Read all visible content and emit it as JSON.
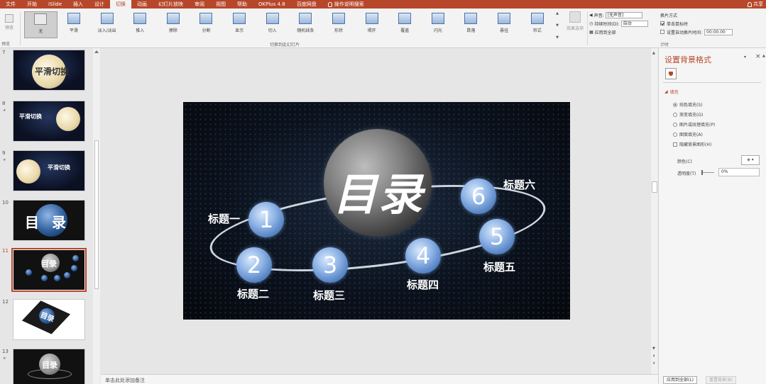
{
  "tabs": [
    "文件",
    "开始",
    "iSlide",
    "插入",
    "设计",
    "切换",
    "动画",
    "幻灯片放映",
    "审阅",
    "视图",
    "帮助",
    "OKPlus 4.8",
    "百度网盘",
    "操作说明搜索"
  ],
  "share": "共享",
  "ribbon": {
    "preview_label": "预览",
    "preview_group": "预览",
    "effects": [
      "无",
      "平滑",
      "淡入/淡出",
      "推入",
      "擦除",
      "分割",
      "显示",
      "切入",
      "随机线条",
      "形状",
      "揭开",
      "覆盖",
      "闪光",
      "跌落",
      "悬挂",
      "帘式"
    ],
    "group_label": "切换到此幻灯片",
    "effect_options": "效果选项",
    "sound_label": "声音:",
    "sound_value": "[无声音]",
    "duration_label": "持续时间(D):",
    "duration_value": "自动",
    "apply_all": "应用到全部",
    "advance_title": "换片方式",
    "on_click": "单击鼠标时",
    "after_time": "设置自动换片时间:",
    "after_value": "00:00.00",
    "timing_group": "计时"
  },
  "thumbnails": [
    {
      "num": "7",
      "text": "平滑切换"
    },
    {
      "num": "8",
      "text": "平滑切换"
    },
    {
      "num": "9",
      "text": "平滑切换"
    },
    {
      "num": "10",
      "text": "目录"
    },
    {
      "num": "11",
      "text": "目录"
    },
    {
      "num": "12",
      "text": "目录"
    },
    {
      "num": "13",
      "text": "目录"
    }
  ],
  "slide": {
    "title": "目录",
    "items": [
      {
        "num": "1",
        "label": "标题一"
      },
      {
        "num": "2",
        "label": "标题二"
      },
      {
        "num": "3",
        "label": "标题三"
      },
      {
        "num": "4",
        "label": "标题四"
      },
      {
        "num": "5",
        "label": "标题五"
      },
      {
        "num": "6",
        "label": "标题六"
      }
    ]
  },
  "notes_placeholder": "单击此处添加备注",
  "pane": {
    "title": "设置背景格式",
    "fill_section": "填充",
    "options": [
      "纯色填充(S)",
      "渐变填充(G)",
      "图片或纹理填充(P)",
      "图案填充(A)"
    ],
    "hide_bg": "隐藏背景图形(H)",
    "color_label": "颜色(C)",
    "transparency_label": "透明度(T)",
    "transparency_value": "0%",
    "apply_all": "应用到全部(L)",
    "reset": "重置背景(B)"
  }
}
